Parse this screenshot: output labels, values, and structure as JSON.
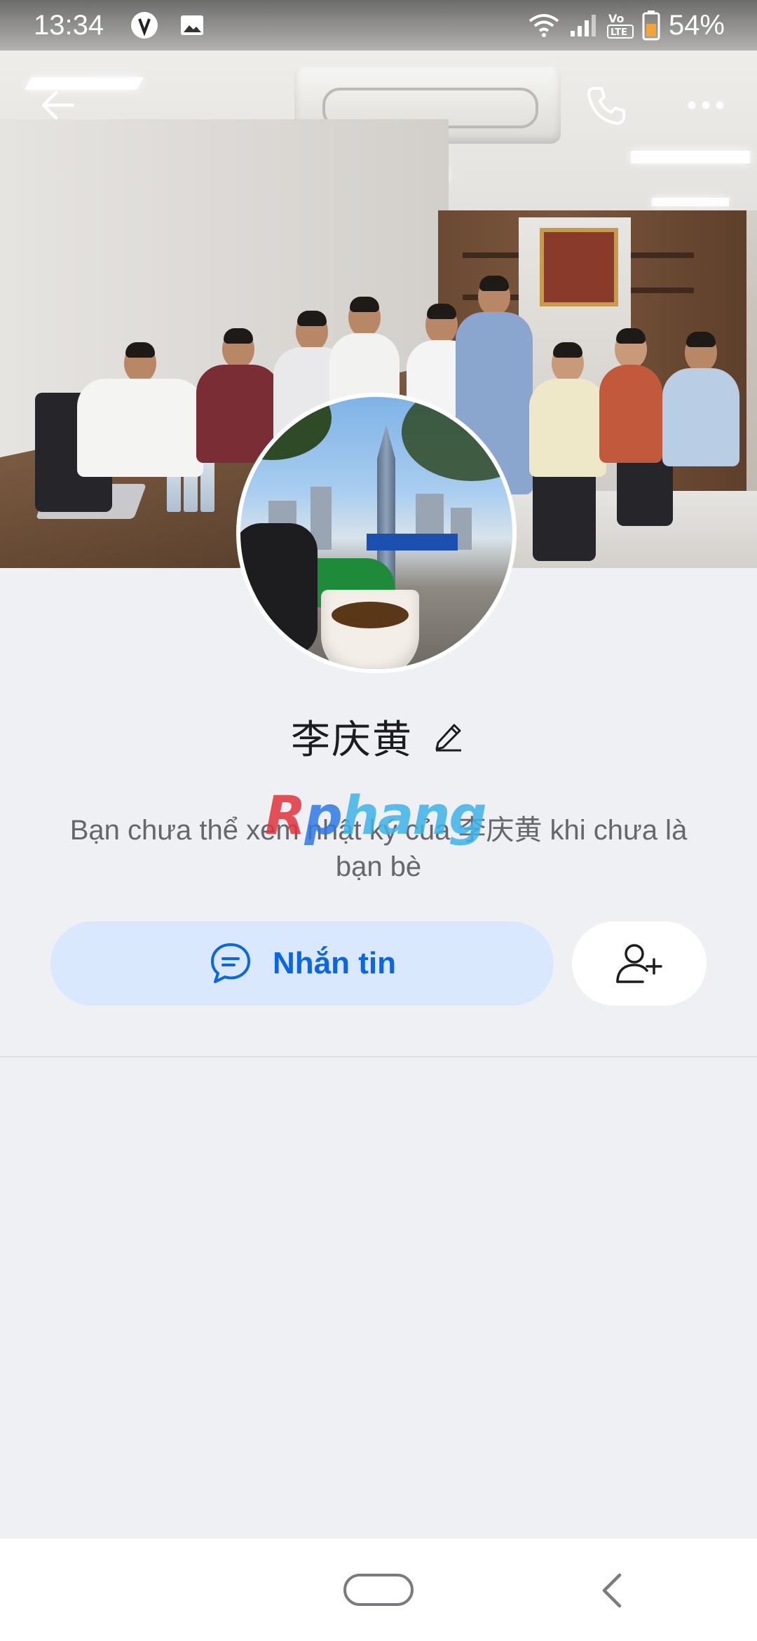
{
  "status_bar": {
    "time": "13:34",
    "battery": "54%",
    "icons": [
      "vpn-shield-icon",
      "gallery-icon",
      "wifi-icon",
      "signal-icon",
      "volte-icon",
      "battery-icon"
    ]
  },
  "header": {
    "back_icon": "arrow-left-icon",
    "call_icon": "phone-icon",
    "more_icon": "more-horizontal-icon"
  },
  "profile": {
    "name": "李庆黄",
    "edit_icon": "pencil-icon",
    "notice": "Bạn chưa thể xem nhật ký của 李庆黄 khi chưa là bạn bè"
  },
  "watermark": {
    "r": "R",
    "p": "p",
    "rest": "hang"
  },
  "actions": {
    "message_label": "Nhắn tin",
    "message_icon": "chat-bubble-icon",
    "add_friend_icon": "add-user-icon"
  },
  "colors": {
    "accent": "#0b66e4",
    "message_bg": "#d9e8fd",
    "background": "#eff0f4"
  }
}
